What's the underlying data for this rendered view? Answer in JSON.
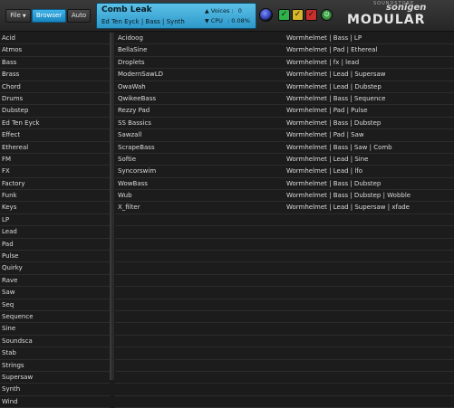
{
  "toolbar": {
    "file_label": "File",
    "browser_label": "Browser",
    "auto_label": "Auto"
  },
  "display": {
    "patch_name": "Comb Leak",
    "patch_tags": "Ed Ten Eyck | Bass | Synth",
    "voices_label": "Voices :",
    "voices_value": "0",
    "cpu_label": "CPU",
    "cpu_value": ": 0.08%"
  },
  "brand": {
    "small": "SOUNDSTORE",
    "top": "sonigen",
    "main": "MODULAR"
  },
  "colors": {
    "accent": "#1fa3dc",
    "check_green": "#2fb14b",
    "check_yellow": "#d8b62a",
    "check_red": "#c9302c"
  },
  "categories": [
    "Acid",
    "Atmos",
    "Bass",
    "Brass",
    "Chord",
    "Drums",
    "Dubstep",
    "Ed Ten Eyck",
    "Effect",
    "Ethereal",
    "FM",
    "FX",
    "Factory",
    "Funk",
    "Keys",
    "LP",
    "Lead",
    "Pad",
    "Pulse",
    "Quirky",
    "Rave",
    "Saw",
    "Seq",
    "Sequence",
    "Sine",
    "Soundsca",
    "Stab",
    "Strings",
    "Supersaw",
    "Synth",
    "Wind"
  ],
  "presets": [
    {
      "name": "Acidoog",
      "tags": "Wormhelmet | Bass | LP"
    },
    {
      "name": "BellaSine",
      "tags": "Wormhelmet | Pad | Ethereal"
    },
    {
      "name": "Droplets",
      "tags": "Wormhelmet | fx | lead"
    },
    {
      "name": "ModernSawLD",
      "tags": "Wormhelmet | Lead | Supersaw"
    },
    {
      "name": "OwaWah",
      "tags": "Wormhelmet | Lead | Dubstep"
    },
    {
      "name": "QwikeeBass",
      "tags": "Wormhelmet | Bass | Sequence"
    },
    {
      "name": "Rezzy Pad",
      "tags": "Wormhelmet | Pad | Pulse"
    },
    {
      "name": "SS Bassics",
      "tags": "Wormhelmet | Bass | Dubstep"
    },
    {
      "name": "Sawzall",
      "tags": "Wormhelmet | Pad | Saw"
    },
    {
      "name": "ScrapeBass",
      "tags": "Wormhelmet | Bass | Saw | Comb"
    },
    {
      "name": "Softie",
      "tags": "Wormhelmet | Lead | Sine"
    },
    {
      "name": "Syncorswim",
      "tags": "Wormhelmet | Lead | lfo"
    },
    {
      "name": "WowBass",
      "tags": "Wormhelmet | Bass | Dubstep"
    },
    {
      "name": "Wub",
      "tags": "Wormhelmet | Bass | Dubstep | Wobble"
    },
    {
      "name": "X_filter",
      "tags": "Wormhelmet | Lead | Supersaw | xfade"
    }
  ]
}
